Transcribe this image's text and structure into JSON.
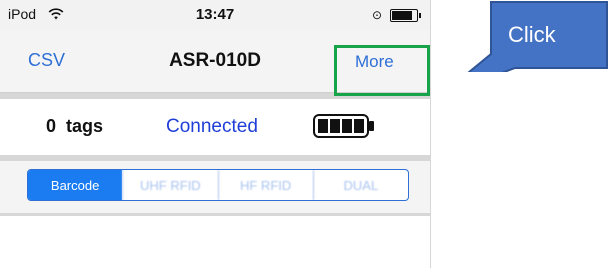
{
  "status_bar": {
    "device": "iPod",
    "time": "13:47",
    "wifi_icon": "wifi-icon",
    "lock_icon": "rotation-lock-icon",
    "battery_level": 0.85
  },
  "nav": {
    "left_label": "CSV",
    "title": "ASR-010D",
    "right_label": "More"
  },
  "info": {
    "count_text": "0  tags",
    "status_text": "Connected",
    "battery_icon": "reader-battery-icon",
    "battery_bars": 4
  },
  "segmented": {
    "items": [
      "Barcode",
      "UHF RFID",
      "HF RFID",
      "DUAL"
    ],
    "selected_index": 0
  },
  "annotation": {
    "callout_text": "Click",
    "highlight_color": "#16a34a",
    "callout_color": "#4472c4"
  },
  "colors": {
    "ios_blue": "#2f6fd6",
    "status_blue": "#1f3fd8",
    "selected_segment": "#1a7cf0"
  }
}
